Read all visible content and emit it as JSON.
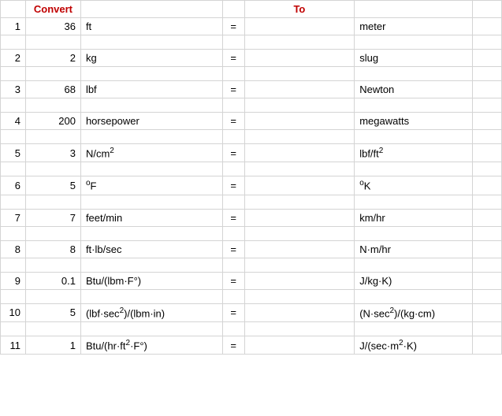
{
  "headers": {
    "convert": "Convert",
    "to": "To"
  },
  "chart_data": {
    "type": "table",
    "columns": [
      "row",
      "value",
      "from_unit",
      "equals",
      "result",
      "to_unit"
    ],
    "rows": [
      {
        "row": "1",
        "value": "36",
        "from_unit": "ft",
        "equals": "=",
        "result": "",
        "to_unit": "meter"
      },
      {
        "row": "2",
        "value": "2",
        "from_unit": "kg",
        "equals": "=",
        "result": "",
        "to_unit": "slug"
      },
      {
        "row": "3",
        "value": "68",
        "from_unit": "lbf",
        "equals": "=",
        "result": "",
        "to_unit": "Newton"
      },
      {
        "row": "4",
        "value": "200",
        "from_unit": "horsepower",
        "equals": "=",
        "result": "",
        "to_unit": "megawatts"
      },
      {
        "row": "5",
        "value": "3",
        "from_unit": "N/cm^2",
        "equals": "=",
        "result": "",
        "to_unit": "lbf/ft^2"
      },
      {
        "row": "6",
        "value": "5",
        "from_unit": "°F",
        "equals": "=",
        "result": "",
        "to_unit": "°K"
      },
      {
        "row": "7",
        "value": "7",
        "from_unit": "feet/min",
        "equals": "=",
        "result": "",
        "to_unit": "km/hr"
      },
      {
        "row": "8",
        "value": "8",
        "from_unit": "ft·lb/sec",
        "equals": "=",
        "result": "",
        "to_unit": "N·m/hr"
      },
      {
        "row": "9",
        "value": "0.1",
        "from_unit": "Btu/(lbm·F°)",
        "equals": "=",
        "result": "",
        "to_unit": "J/kg·K)"
      },
      {
        "row": "10",
        "value": "5",
        "from_unit": "(lbf·sec^2)/(lbm·in)",
        "equals": "=",
        "result": "",
        "to_unit": "(N·sec^2)/(kg·cm)"
      },
      {
        "row": "11",
        "value": "1",
        "from_unit": "Btu/(hr·ft^2·F°)",
        "equals": "=",
        "result": "",
        "to_unit": "J/(sec·m^2·K)"
      }
    ]
  }
}
